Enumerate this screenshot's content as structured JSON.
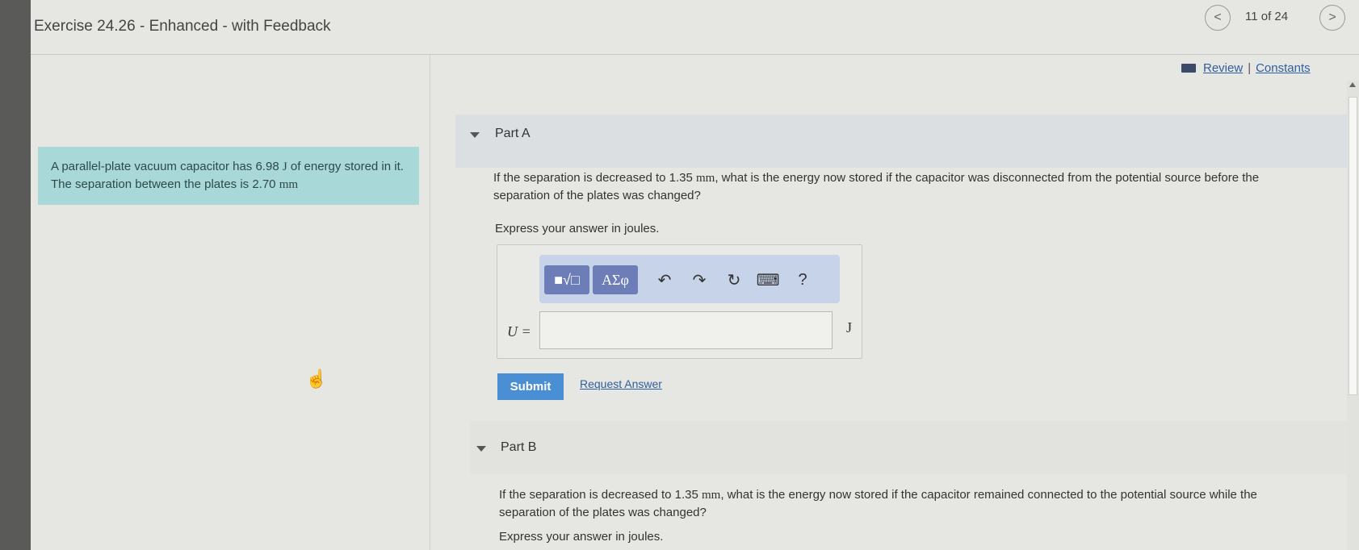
{
  "header": {
    "title": "Exercise 24.26 - Enhanced - with Feedback",
    "nav_prev": "<",
    "nav_next": ">",
    "position": "11 of 24"
  },
  "links": {
    "review": "Review",
    "separator": "|",
    "constants": "Constants"
  },
  "problem": {
    "text_1": "A parallel-plate vacuum capacitor has 6.98 ",
    "unit_energy": "J",
    "text_2": " of energy stored in it. The separation between the plates is 2.70 ",
    "unit_length": "mm"
  },
  "part_a": {
    "label": "Part A",
    "question_1": "If the separation is decreased to 1.35 ",
    "question_unit": "mm",
    "question_2": ", what is the energy now stored if the capacitor was disconnected from the potential source before the separation of the plates was changed?",
    "instruction": "Express your answer in joules.",
    "toolbar": {
      "templates_label": "■√□",
      "symbols_label": "ΑΣφ",
      "undo_icon": "↶",
      "redo_icon": "↷",
      "reset_icon": "↻",
      "keyboard_icon": "⌨",
      "help_label": "?"
    },
    "variable": "U =",
    "input_value": "",
    "unit": "J",
    "submit_label": "Submit",
    "request_label": "Request Answer"
  },
  "part_b": {
    "label": "Part B",
    "question_1": "If the separation is decreased to 1.35 ",
    "question_unit": "mm",
    "question_2": ", what is the energy now stored if the capacitor remained connected to the potential source while the separation of the plates was changed?",
    "instruction": "Express your answer in joules."
  }
}
